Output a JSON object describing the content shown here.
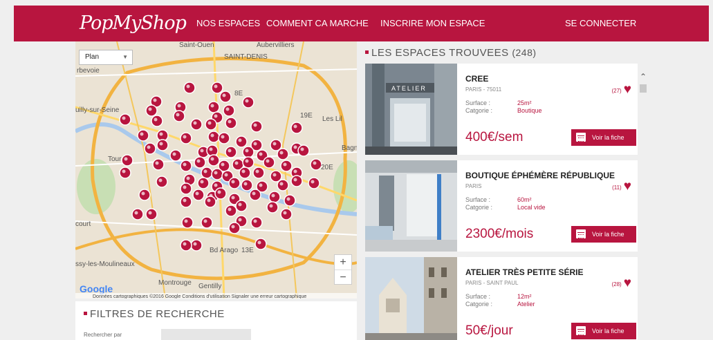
{
  "header": {
    "logo": "PopMyShop",
    "nav": {
      "espaces": "NOS ESPACES",
      "comment": "COMMENT CA MARCHE",
      "inscrire": "INSCRIRE MON ESPACE",
      "connecter": "SE CONNECTER"
    }
  },
  "map": {
    "type_select": "Plan",
    "zoom_in": "+",
    "zoom_out": "−",
    "google": "Google",
    "attribution": "Données cartographiques ©2016 Google   Conditions d'utilisation   Signaler une erreur cartographique",
    "place_labels": [
      "rbevoie",
      "uilly-sur-Seine",
      "Les Lil",
      "Bagn",
      "court",
      "ssy-les-Moulineaux",
      "Montrouge",
      "Gentilly",
      "Saint-Ouen",
      "Aubervilliers",
      "SAINT-DENIS",
      "8E",
      "19E",
      "20E",
      "13E",
      "Bd Arago",
      "Tour"
    ]
  },
  "filters": {
    "title": "FILTRES DE RECHERCHE",
    "search_label": "Rechercher par",
    "search_value": ""
  },
  "results": {
    "title": "LES ESPACES TROUVEES",
    "count": "(248)",
    "surface_label": "Surface :",
    "category_label": "Catgorie :",
    "button_label": "Voir la fiche",
    "items": [
      {
        "title": "CREE",
        "location": "PARIS - 75011",
        "likes": "(27)",
        "surface": "25m²",
        "category": "Boutique",
        "price": "400€/sem"
      },
      {
        "title": "BOUTIQUE ÉPHÉMÈRE RÉPUBLIQUE",
        "location": "PARIS",
        "likes": "(11)",
        "surface": "60m²",
        "category": "Local vide",
        "price": "2300€/mois"
      },
      {
        "title": "ATELIER TRÈS PETITE SÉRIE",
        "location": "PARIS - SAINT PAUL",
        "likes": "(28)",
        "surface": "12m²",
        "category": "Atelier",
        "price": "50€/jour"
      }
    ]
  },
  "thumb_texts": {
    "atelier_sign": "ATELIER"
  },
  "colors": {
    "brand": "#b8153f",
    "background": "#efefef"
  },
  "icons": {
    "heart": "♥",
    "calendar": "calendar-icon",
    "scroll_up": "⌃"
  }
}
